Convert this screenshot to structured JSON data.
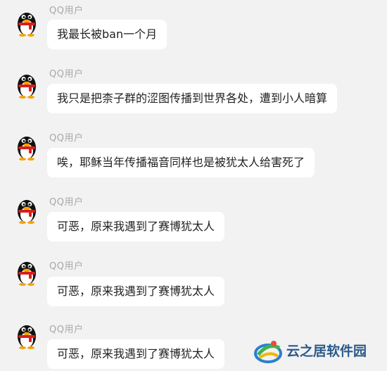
{
  "messages": [
    {
      "sender": "QQ用户",
      "text": "我最长被ban一个月"
    },
    {
      "sender": "QQ用户",
      "text": "我只是把柰子群的涩图传播到世界各处，遭到小人暗算"
    },
    {
      "sender": "QQ用户",
      "text": "唉，耶稣当年传播福音同样也是被犹太人给害死了"
    },
    {
      "sender": "QQ用户",
      "text": "可恶，原来我遇到了赛博犹太人"
    },
    {
      "sender": "QQ用户",
      "text": "可恶，原来我遇到了赛博犹太人"
    },
    {
      "sender": "QQ用户",
      "text": "可恶，原来我遇到了赛博犹太人"
    }
  ],
  "watermark": {
    "text": "云之居软件园"
  },
  "colors": {
    "background": "#f2f2f2",
    "bubble": "#ffffff",
    "sender": "#a8a8a8"
  }
}
